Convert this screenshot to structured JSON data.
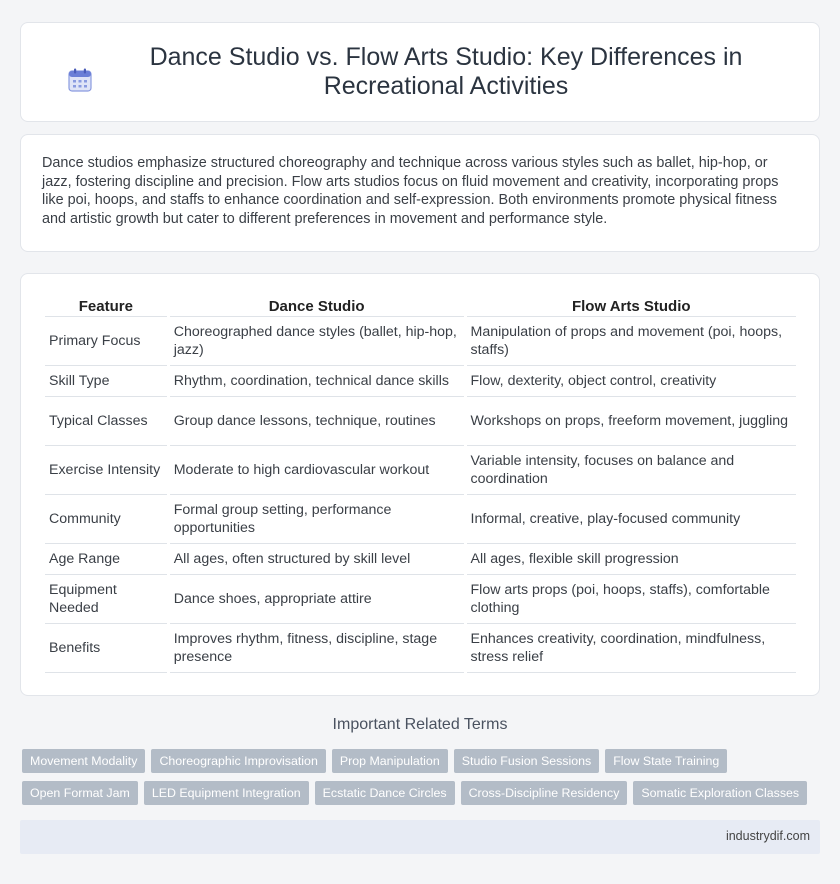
{
  "header": {
    "icon": "calendar-icon",
    "title": "Dance Studio vs. Flow Arts Studio: Key Differences in Recreational Activities"
  },
  "intro": {
    "text": "Dance studios emphasize structured choreography and technique across various styles such as ballet, hip-hop, or jazz, fostering discipline and precision. Flow arts studios focus on fluid movement and creativity, incorporating props like poi, hoops, and staffs to enhance coordination and self-expression. Both environments promote physical fitness and artistic growth but cater to different preferences in movement and performance style."
  },
  "table": {
    "headers": [
      "Feature",
      "Dance Studio",
      "Flow Arts Studio"
    ],
    "rows": [
      [
        "Primary Focus",
        "Choreographed dance styles (ballet, hip-hop, jazz)",
        "Manipulation of props and movement (poi, hoops, staffs)"
      ],
      [
        "Skill Type",
        "Rhythm, coordination, technical dance skills",
        "Flow, dexterity, object control, creativity"
      ],
      [
        "Typical Classes",
        "Group dance lessons, technique, routines",
        "Workshops on props, freeform movement, juggling"
      ],
      [
        "Exercise Intensity",
        "Moderate to high cardiovascular workout",
        "Variable intensity, focuses on balance and coordination"
      ],
      [
        "Community",
        "Formal group setting, performance opportunities",
        "Informal, creative, play-focused community"
      ],
      [
        "Age Range",
        "All ages, often structured by skill level",
        "All ages, flexible skill progression"
      ],
      [
        "Equipment Needed",
        "Dance shoes, appropriate attire",
        "Flow arts props (poi, hoops, staffs), comfortable clothing"
      ],
      [
        "Benefits",
        "Improves rhythm, fitness, discipline, stage presence",
        "Enhances creativity, coordination, mindfulness, stress relief"
      ]
    ]
  },
  "related": {
    "heading": "Important Related Terms",
    "tags": [
      "Movement Modality",
      "Choreographic Improvisation",
      "Prop Manipulation",
      "Studio Fusion Sessions",
      "Flow State Training",
      "Open Format Jam",
      "LED Equipment Integration",
      "Ecstatic Dance Circles",
      "Cross-Discipline Residency",
      "Somatic Exploration Classes"
    ]
  },
  "footer": {
    "site": "industrydif.com"
  },
  "colors": {
    "tag_bg": "#b3bcc7",
    "footer_bg": "#e7ebf4",
    "icon_accent": "#6b7fd7"
  }
}
